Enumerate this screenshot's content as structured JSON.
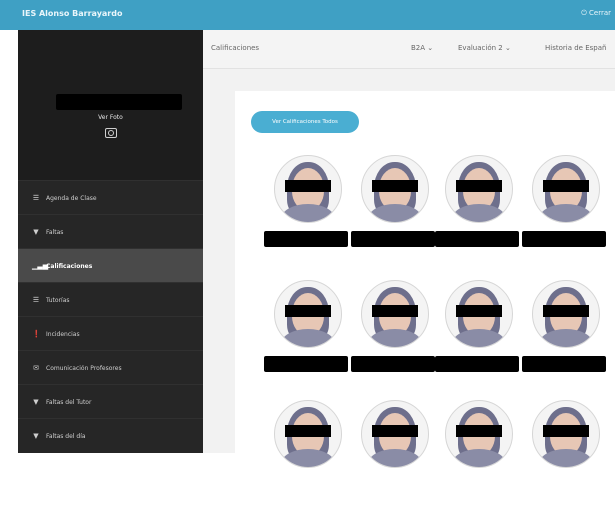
{
  "app": {
    "title": "IES Alonso Barrayardo",
    "user_menu": "⏻ Cerrar"
  },
  "profile": {
    "ver_foto": "Ver Foto",
    "camera_icon": "camera-icon"
  },
  "sidebar": {
    "items": [
      {
        "label": "Agenda de Clase",
        "icon": "☰"
      },
      {
        "label": "Faltas",
        "icon": "▼"
      },
      {
        "label": "Calificaciones",
        "icon": "▁▃▅",
        "active": true
      },
      {
        "label": "Tutorías",
        "icon": "☰"
      },
      {
        "label": "Incidencias",
        "icon": "❗"
      },
      {
        "label": "Comunicación Profesores",
        "icon": "✉"
      },
      {
        "label": "Faltas del Tutor",
        "icon": "▼"
      },
      {
        "label": "Faltas del día",
        "icon": "▼"
      }
    ]
  },
  "header": {
    "breadcrumb": "Calificaciones",
    "group": "B2A",
    "evaluation": "Evaluación 2",
    "subject": "Historia de Españ"
  },
  "main": {
    "button_all": "Ver Calificaciones Todos",
    "students_count_visible": 12
  },
  "colors": {
    "topbar": "#3fa0c4",
    "sidebar": "#262626",
    "accent": "#4aaed2"
  }
}
